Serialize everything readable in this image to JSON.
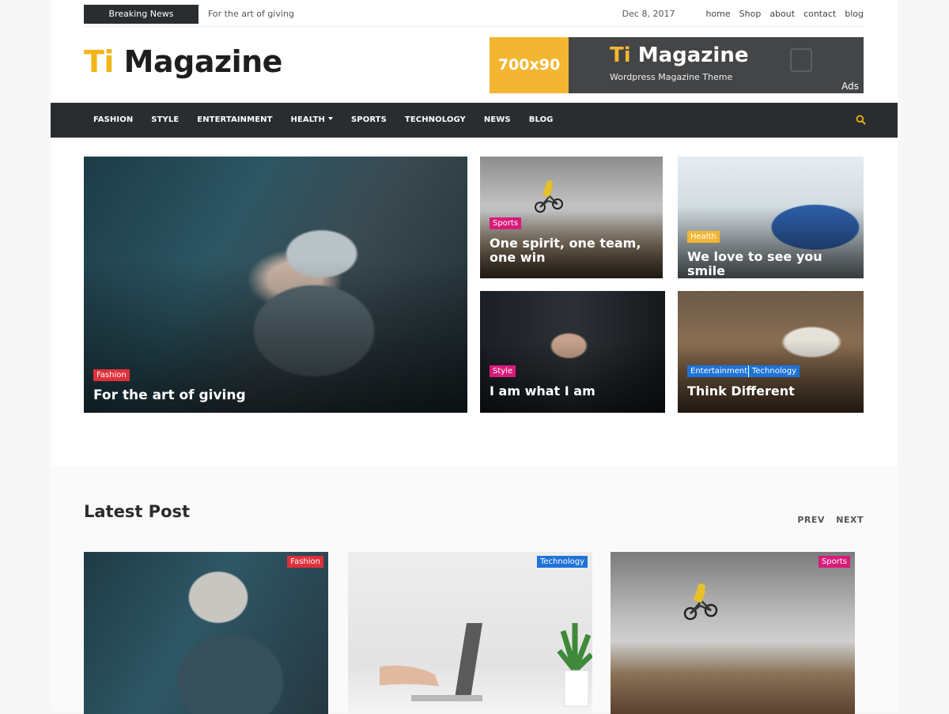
{
  "topbar": {
    "breaking_label": "Breaking News",
    "ticker_text": "For the art of giving",
    "date": "Dec 8, 2017",
    "links": [
      "home",
      "Shop",
      "about",
      "contact",
      "blog"
    ]
  },
  "logo": {
    "ti": "Ti",
    "name": " Magazine"
  },
  "ad": {
    "size": "700x90",
    "brand_ti": "Ti",
    "brand_name": " Magazine",
    "tagline": "Wordpress Magazine Theme",
    "label": "Ads"
  },
  "nav": {
    "items": [
      "FASHION",
      "STYLE",
      "ENTERTAINMENT",
      "HEALTH",
      "SPORTS",
      "TECHNOLOGY",
      "NEWS",
      "BLOG"
    ]
  },
  "featured": {
    "main": {
      "category": "Fashion",
      "title": "For the art of giving"
    },
    "sports": {
      "category": "Sports",
      "title": "One spirit, one team, one win"
    },
    "health": {
      "category": "Health",
      "title": "We love to see you smile"
    },
    "style": {
      "category": "Style",
      "title": "I am what I am"
    },
    "think": {
      "categories": [
        "Entertainment",
        "Technology"
      ],
      "title": "Think Different"
    }
  },
  "latest": {
    "heading": "Latest Post",
    "prev": "PREV",
    "next": "NEXT",
    "cards": [
      {
        "category": "Fashion"
      },
      {
        "category": "Technology"
      },
      {
        "category": "Sports"
      }
    ]
  },
  "colors": {
    "accent": "#f3b51a",
    "nav_bg": "#2a2d2f",
    "sports": "#d81b7a",
    "fashion": "#e0303b",
    "health": "#f3b632",
    "tech": "#1e73d8"
  }
}
